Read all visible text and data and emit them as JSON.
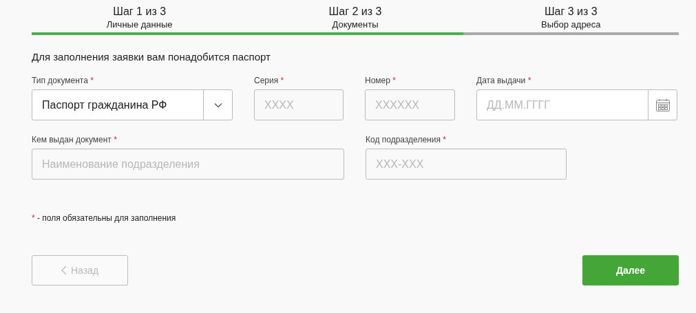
{
  "steps": [
    {
      "title": "Шаг 1 из 3",
      "subtitle": "Личные данные",
      "completed": true
    },
    {
      "title": "Шаг 2 из 3",
      "subtitle": "Документы",
      "completed": true
    },
    {
      "title": "Шаг 3 из 3",
      "subtitle": "Выбор адреса",
      "completed": false
    }
  ],
  "heading": "Для заполнения заявки вам понадобится паспорт",
  "field_rows": [
    [
      {
        "kind": "select",
        "label": "Тип документа",
        "asterisk": "*",
        "value": "Паспорт гражданина РФ"
      },
      {
        "kind": "text",
        "label": "Серия",
        "asterisk": "*",
        "placeholder": "XXXX"
      },
      {
        "kind": "text",
        "label": "Номер",
        "asterisk": "*",
        "placeholder": "XXXXXX"
      },
      {
        "kind": "date",
        "label": "Дата выдачи",
        "asterisk": "*",
        "placeholder": "ДД.ММ.ГГГГ"
      }
    ],
    [
      {
        "kind": "text",
        "label": "Кем выдан документ",
        "asterisk": "*",
        "placeholder": "Наименование подразделения"
      },
      {
        "kind": "text",
        "label": "Код подразделения",
        "asterisk": "*",
        "placeholder": "XXX-XXX"
      }
    ]
  ],
  "required_note": {
    "asterisk": "*",
    "text": "- поля обязательны для заполнения"
  },
  "back_button": {
    "label": "Назад",
    "disabled": true
  },
  "next_button": {
    "label": "Далее",
    "disabled": false
  }
}
